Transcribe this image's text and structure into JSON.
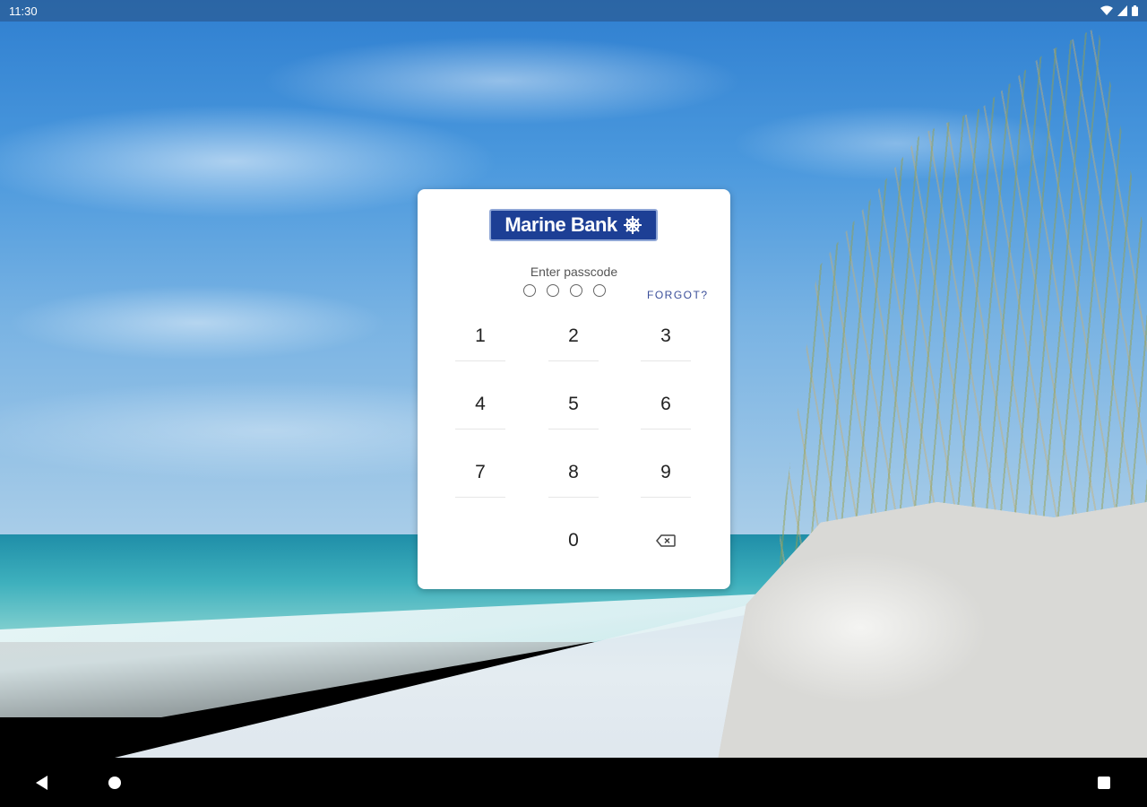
{
  "status_bar": {
    "time": "11:30",
    "icons": [
      "wifi-icon",
      "signal-icon",
      "battery-icon"
    ]
  },
  "dialog": {
    "logo_text": "Marine Bank",
    "prompt": "Enter passcode",
    "passcode_length": 4,
    "forgot_label": "FORGOT?",
    "keys": [
      "1",
      "2",
      "3",
      "4",
      "5",
      "6",
      "7",
      "8",
      "9",
      "0"
    ],
    "backspace_icon": "backspace-icon"
  },
  "nav_bar": {
    "buttons": [
      "back-icon",
      "home-icon",
      "recents-icon"
    ]
  },
  "colors": {
    "brand": "#1d3f95",
    "link": "#3b4f9a"
  }
}
